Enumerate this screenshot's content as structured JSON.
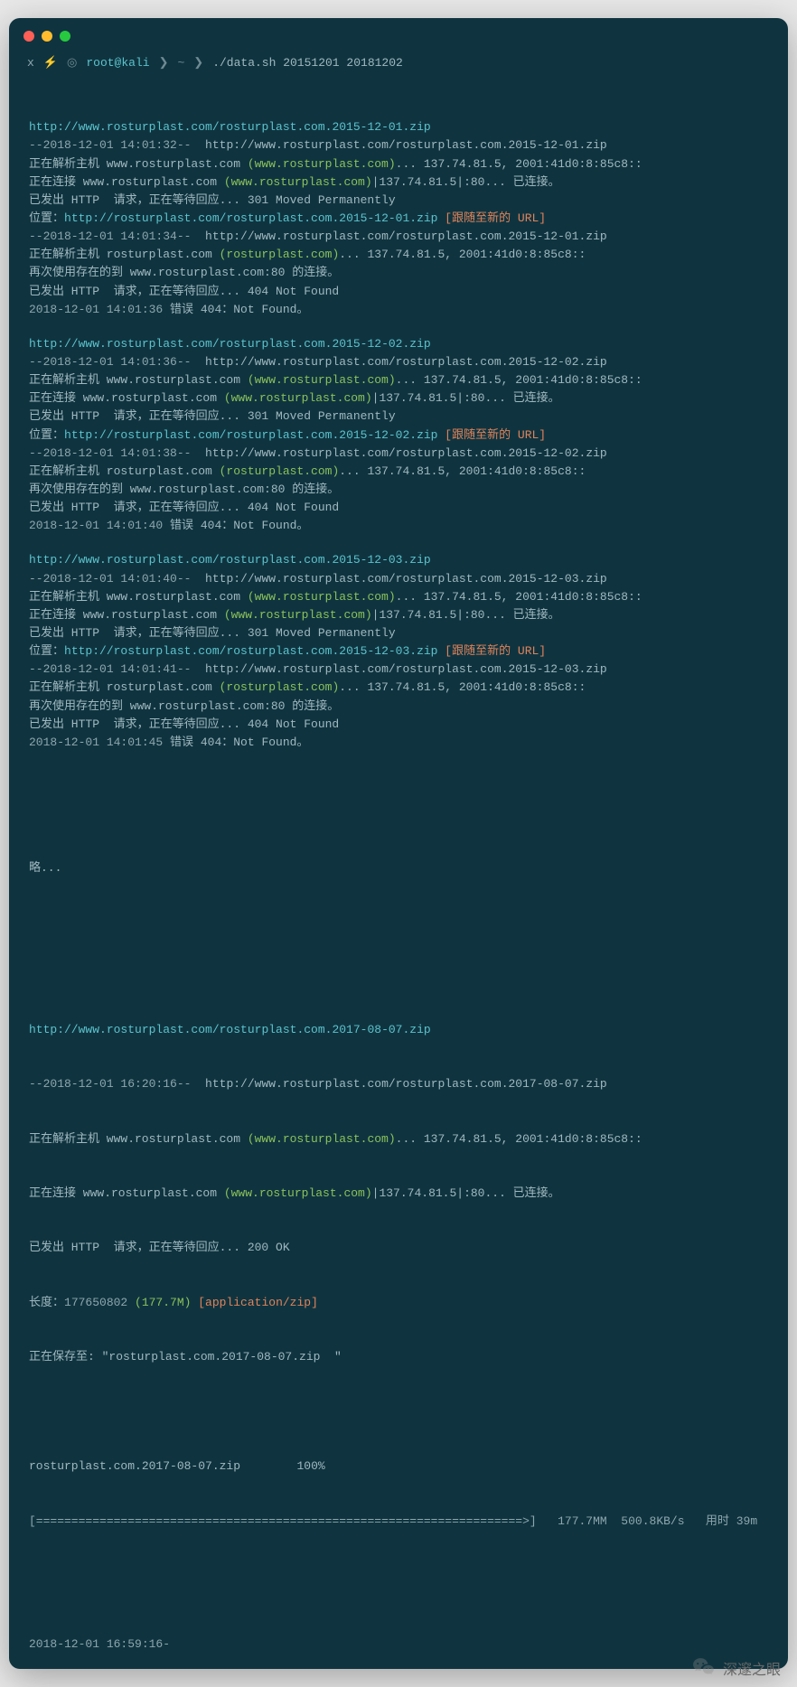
{
  "prompt": {
    "x": "x",
    "bolt": "⚡",
    "ring": "◎",
    "user": "root@kali",
    "sep1": "❯",
    "path": "~",
    "sep2": "❯",
    "command": "./data.sh 20151201 20181202"
  },
  "blocks": [
    {
      "date": "2015-12-01",
      "url_header": "http://www.rosturplast.com/rosturplast.com.2015-12-01.zip",
      "ts1": "--2018-12-01 14:01:32--",
      "full_url1": "http://www.rosturplast.com/rosturplast.com.2015-12-01.zip",
      "resolv_host": "正在解析主机 www.rosturplast.com ",
      "host_paren": "(www.rosturplast.com)",
      "resolv_ips": "... 137.74.81.5, 2001:41d0:8:85c8::",
      "conn_host": "正在连接 www.rosturplast.com ",
      "conn_tail": "|137.74.81.5|:80... 已连接。",
      "http_301": "已发出 HTTP  请求，正在等待回应... 301 Moved Permanently",
      "loc_prefix": "位置：",
      "loc_url": "http://rosturplast.com/rosturplast.com.2015-12-01.zip",
      "loc_follow": " [跟随至新的 URL]",
      "ts2": "--2018-12-01 14:01:34--",
      "full_url2": "http://www.rosturplast.com/rosturplast.com.2015-12-01.zip",
      "resolv2_host": "正在解析主机 rosturplast.com ",
      "host2_paren": "(rosturplast.com)",
      "resolv2_ips": "... 137.74.81.5, 2001:41d0:8:85c8::",
      "reuse": "再次使用存在的到 www.rosturplast.com:80 的连接。",
      "http_404": "已发出 HTTP  请求，正在等待回应... 404 Not Found",
      "err_ts": "2018-12-01 14:01:36",
      "err_msg": " 错误 404：Not Found。"
    },
    {
      "date": "2015-12-02",
      "url_header": "http://www.rosturplast.com/rosturplast.com.2015-12-02.zip",
      "ts1": "--2018-12-01 14:01:36--",
      "full_url1": "http://www.rosturplast.com/rosturplast.com.2015-12-02.zip",
      "resolv_host": "正在解析主机 www.rosturplast.com ",
      "host_paren": "(www.rosturplast.com)",
      "resolv_ips": "... 137.74.81.5, 2001:41d0:8:85c8::",
      "conn_host": "正在连接 www.rosturplast.com ",
      "conn_tail": "|137.74.81.5|:80... 已连接。",
      "http_301": "已发出 HTTP  请求，正在等待回应... 301 Moved Permanently",
      "loc_prefix": "位置：",
      "loc_url": "http://rosturplast.com/rosturplast.com.2015-12-02.zip",
      "loc_follow": " [跟随至新的 URL]",
      "ts2": "--2018-12-01 14:01:38--",
      "full_url2": "http://www.rosturplast.com/rosturplast.com.2015-12-02.zip",
      "resolv2_host": "正在解析主机 rosturplast.com ",
      "host2_paren": "(rosturplast.com)",
      "resolv2_ips": "... 137.74.81.5, 2001:41d0:8:85c8::",
      "reuse": "再次使用存在的到 www.rosturplast.com:80 的连接。",
      "http_404": "已发出 HTTP  请求，正在等待回应... 404 Not Found",
      "err_ts": "2018-12-01 14:01:40",
      "err_msg": " 错误 404：Not Found。"
    },
    {
      "date": "2015-12-03",
      "url_header": "http://www.rosturplast.com/rosturplast.com.2015-12-03.zip",
      "ts1": "--2018-12-01 14:01:40--",
      "full_url1": "http://www.rosturplast.com/rosturplast.com.2015-12-03.zip",
      "resolv_host": "正在解析主机 www.rosturplast.com ",
      "host_paren": "(www.rosturplast.com)",
      "resolv_ips": "... 137.74.81.5, 2001:41d0:8:85c8::",
      "conn_host": "正在连接 www.rosturplast.com ",
      "conn_tail": "|137.74.81.5|:80... 已连接。",
      "http_301": "已发出 HTTP  请求，正在等待回应... 301 Moved Permanently",
      "loc_prefix": "位置：",
      "loc_url": "http://rosturplast.com/rosturplast.com.2015-12-03.zip",
      "loc_follow": " [跟随至新的 URL]",
      "ts2": "--2018-12-01 14:01:41--",
      "full_url2": "http://www.rosturplast.com/rosturplast.com.2015-12-03.zip",
      "resolv2_host": "正在解析主机 rosturplast.com ",
      "host2_paren": "(rosturplast.com)",
      "resolv2_ips": "... 137.74.81.5, 2001:41d0:8:85c8::",
      "reuse": "再次使用存在的到 www.rosturplast.com:80 的连接。",
      "http_404": "已发出 HTTP  请求，正在等待回应... 404 Not Found",
      "err_ts": "2018-12-01 14:01:45",
      "err_msg": " 错误 404：Not Found。"
    }
  ],
  "ellipsis": "略...",
  "success": {
    "url_header": "http://www.rosturplast.com/rosturplast.com.2017-08-07.zip",
    "ts1": "--2018-12-01 16:20:16--",
    "full_url1": "http://www.rosturplast.com/rosturplast.com.2017-08-07.zip",
    "resolv_host": "正在解析主机 www.rosturplast.com ",
    "host_paren": "(www.rosturplast.com)",
    "resolv_ips": "... 137.74.81.5, 2001:41d0:8:85c8::",
    "conn_host": "正在连接 www.rosturplast.com ",
    "conn_tail": "|137.74.81.5|:80... 已连接。",
    "http_200": "已发出 HTTP  请求，正在等待回应... 200 OK",
    "len_prefix": "长度：",
    "len_bytes": "177650802 ",
    "len_human": "(177.7M)",
    "len_type": " [application/zip]",
    "saving": "正在保存至: \"rosturplast.com.2017-08-07.zip  \"",
    "progress_name": "rosturplast.com.2017-08-07.zip",
    "progress_pct": "100%",
    "progress_bar": "[=====================================================================>]   177.7MM  500.8KB/s   用时 39m"
  },
  "footer_ts": "2018-12-01 16:59:16-",
  "wechat": "深邃之眼"
}
